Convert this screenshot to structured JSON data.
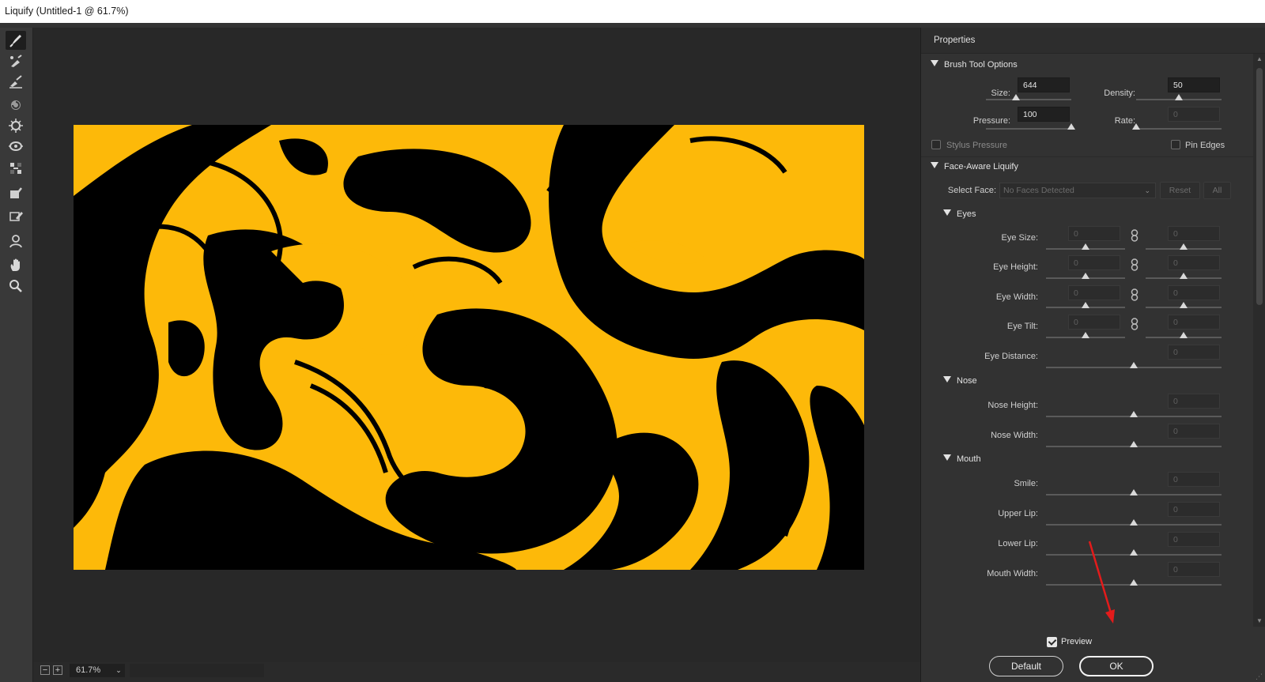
{
  "window": {
    "title": "Liquify (Untitled-1 @ 61.7%)"
  },
  "toolbar": {
    "tools": [
      {
        "name": "forward-warp-tool-icon",
        "active": true
      },
      {
        "name": "reconstruct-tool-icon"
      },
      {
        "name": "smooth-tool-icon"
      },
      {
        "name": "twirl-clockwise-tool-icon"
      },
      {
        "name": "pucker-tool-icon"
      },
      {
        "name": "bloat-tool-icon"
      },
      {
        "name": "push-left-tool-icon"
      },
      {
        "name": "freeze-mask-tool-icon"
      },
      {
        "name": "thaw-mask-tool-icon"
      },
      {
        "name": "face-tool-icon"
      },
      {
        "name": "hand-tool-icon"
      },
      {
        "name": "zoom-tool-icon"
      }
    ]
  },
  "canvas": {
    "background": "#fdb909",
    "stroke": "#000000"
  },
  "status": {
    "zoom": "61.7%"
  },
  "panel": {
    "title": "Properties",
    "brush": {
      "header": "Brush Tool Options",
      "size_label": "Size:",
      "size_value": "644",
      "size_level": 0.35,
      "density_label": "Density:",
      "density_value": "50",
      "density_level": 0.5,
      "pressure_label": "Pressure:",
      "pressure_value": "100",
      "pressure_level": 1.0,
      "rate_label": "Rate:",
      "rate_value": "0",
      "rate_level": 0.0,
      "stylus_label": "Stylus Pressure",
      "stylus_checked": false,
      "pin_label": "Pin Edges",
      "pin_checked": false
    },
    "face": {
      "header": "Face-Aware Liquify",
      "select_label": "Select Face:",
      "select_value": "No Faces Detected",
      "reset_label": "Reset",
      "all_label": "All",
      "eyes": {
        "header": "Eyes",
        "size_label": "Eye Size:",
        "size_left": "0",
        "size_right": "0",
        "height_label": "Eye Height:",
        "height_left": "0",
        "height_right": "0",
        "width_label": "Eye Width:",
        "width_left": "0",
        "width_right": "0",
        "tilt_label": "Eye Tilt:",
        "tilt_left": "0",
        "tilt_right": "0",
        "distance_label": "Eye Distance:",
        "distance_value": "0"
      },
      "nose": {
        "header": "Nose",
        "height_label": "Nose Height:",
        "height_value": "0",
        "width_label": "Nose Width:",
        "width_value": "0"
      },
      "mouth": {
        "header": "Mouth",
        "smile_label": "Smile:",
        "smile_value": "0",
        "upper_lip_label": "Upper Lip:",
        "upper_lip_value": "0",
        "lower_lip_label": "Lower Lip:",
        "lower_lip_value": "0",
        "mouth_width_label": "Mouth Width:",
        "mouth_width_value": "0"
      }
    },
    "preview_label": "Preview",
    "preview_checked": true,
    "default_label": "Default",
    "ok_label": "OK",
    "annotation_color": "#e31b1b"
  }
}
